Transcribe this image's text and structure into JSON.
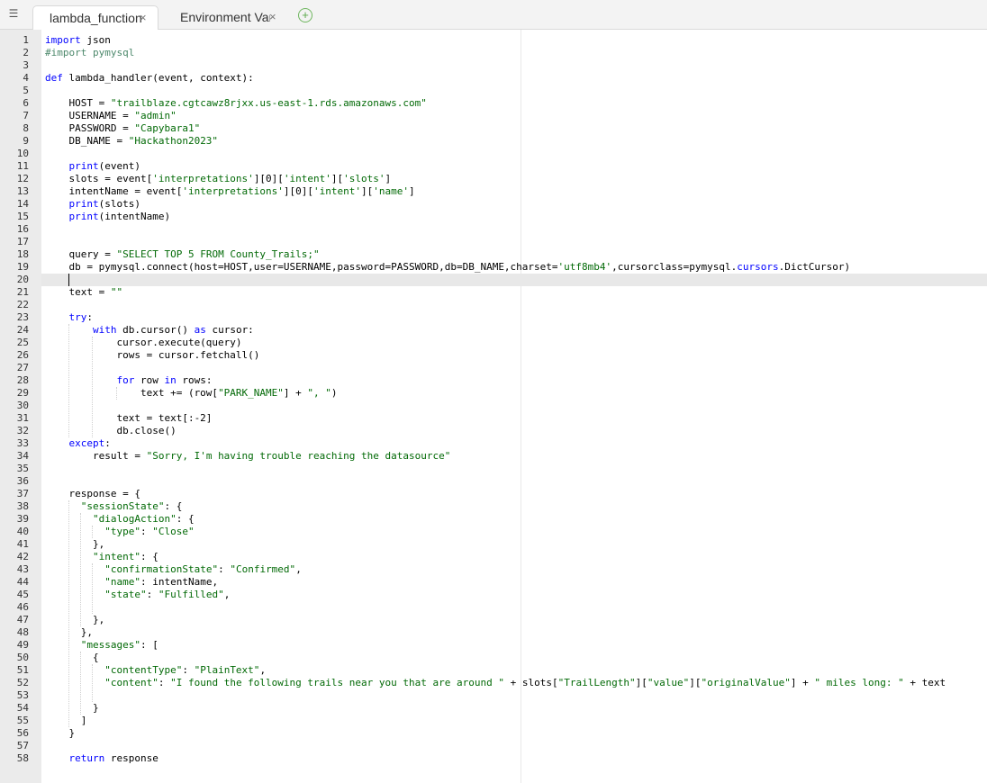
{
  "tabs": [
    {
      "label": "lambda_function",
      "close": "×",
      "active": true
    },
    {
      "label": "Environment Var",
      "close": "×",
      "active": false
    }
  ],
  "add_tab": "+",
  "colors": {
    "keyword": "#0000ff",
    "string": "#036a07",
    "comment": "#4c886b",
    "gutter_bg": "#ebebeb",
    "add_tab": "#5aa84a"
  },
  "icons": {
    "menu": "list-menu-icon",
    "add": "plus-circle-icon",
    "close": "close-icon"
  },
  "editor": {
    "cursor_line": 20,
    "lines": [
      [
        [
          "k",
          "import"
        ],
        [
          "p",
          " json"
        ]
      ],
      [
        [
          "c",
          "#import pymysql"
        ]
      ],
      [],
      [
        [
          "k",
          "def"
        ],
        [
          "p",
          " lambda_handler(event, context):"
        ]
      ],
      [],
      [
        [
          "p",
          "    HOST = "
        ],
        [
          "s",
          "\"trailblaze.cgtcawz8rjxx.us-east-1.rds.amazonaws.com\""
        ]
      ],
      [
        [
          "p",
          "    USERNAME = "
        ],
        [
          "s",
          "\"admin\""
        ]
      ],
      [
        [
          "p",
          "    PASSWORD = "
        ],
        [
          "s",
          "\"Capybara1\""
        ]
      ],
      [
        [
          "p",
          "    DB_NAME = "
        ],
        [
          "s",
          "\"Hackathon2023\""
        ]
      ],
      [],
      [
        [
          "p",
          "    "
        ],
        [
          "k",
          "print"
        ],
        [
          "p",
          "(event)"
        ]
      ],
      [
        [
          "p",
          "    slots = event["
        ],
        [
          "s",
          "'interpretations'"
        ],
        [
          "p",
          "][0]["
        ],
        [
          "s",
          "'intent'"
        ],
        [
          "p",
          "]["
        ],
        [
          "s",
          "'slots'"
        ],
        [
          "p",
          "]"
        ]
      ],
      [
        [
          "p",
          "    intentName = event["
        ],
        [
          "s",
          "'interpretations'"
        ],
        [
          "p",
          "][0]["
        ],
        [
          "s",
          "'intent'"
        ],
        [
          "p",
          "]["
        ],
        [
          "s",
          "'name'"
        ],
        [
          "p",
          "]"
        ]
      ],
      [
        [
          "p",
          "    "
        ],
        [
          "k",
          "print"
        ],
        [
          "p",
          "(slots)"
        ]
      ],
      [
        [
          "p",
          "    "
        ],
        [
          "k",
          "print"
        ],
        [
          "p",
          "(intentName)"
        ]
      ],
      [],
      [],
      [
        [
          "p",
          "    query = "
        ],
        [
          "s",
          "\"SELECT TOP 5 FROM County_Trails;\""
        ]
      ],
      [
        [
          "p",
          "    db = pymysql.connect(host=HOST,user=USERNAME,password=PASSWORD,db=DB_NAME,charset="
        ],
        [
          "s",
          "'utf8mb4'"
        ],
        [
          "p",
          ",cursorclass=pymysql."
        ],
        [
          "k",
          "cursors"
        ],
        [
          "p",
          ".DictCursor)"
        ]
      ],
      [],
      [
        [
          "p",
          "    text = "
        ],
        [
          "s",
          "\"\""
        ]
      ],
      [],
      [
        [
          "p",
          "    "
        ],
        [
          "k",
          "try"
        ],
        [
          "p",
          ":"
        ]
      ],
      [
        [
          "p",
          "        "
        ],
        [
          "k",
          "with"
        ],
        [
          "p",
          " db.cursor() "
        ],
        [
          "k",
          "as"
        ],
        [
          "p",
          " cursor:"
        ]
      ],
      [
        [
          "p",
          "            cursor.execute(query)"
        ]
      ],
      [
        [
          "p",
          "            rows = cursor.fetchall()"
        ]
      ],
      [],
      [
        [
          "p",
          "            "
        ],
        [
          "k",
          "for"
        ],
        [
          "p",
          " row "
        ],
        [
          "k",
          "in"
        ],
        [
          "p",
          " rows:"
        ]
      ],
      [
        [
          "p",
          "                text += (row["
        ],
        [
          "s",
          "\"PARK_NAME\""
        ],
        [
          "p",
          "] + "
        ],
        [
          "s",
          "\", \""
        ],
        [
          "p",
          ")"
        ]
      ],
      [],
      [
        [
          "p",
          "            text = text[:-2]"
        ]
      ],
      [
        [
          "p",
          "            db.close()"
        ]
      ],
      [
        [
          "p",
          "    "
        ],
        [
          "k",
          "except"
        ],
        [
          "p",
          ":"
        ]
      ],
      [
        [
          "p",
          "        result = "
        ],
        [
          "s",
          "\"Sorry, I'm having trouble reaching the datasource\""
        ]
      ],
      [],
      [],
      [
        [
          "p",
          "    response = {"
        ]
      ],
      [
        [
          "p",
          "      "
        ],
        [
          "s",
          "\"sessionState\""
        ],
        [
          "p",
          ": {"
        ]
      ],
      [
        [
          "p",
          "        "
        ],
        [
          "s",
          "\"dialogAction\""
        ],
        [
          "p",
          ": {"
        ]
      ],
      [
        [
          "p",
          "          "
        ],
        [
          "s",
          "\"type\""
        ],
        [
          "p",
          ": "
        ],
        [
          "s",
          "\"Close\""
        ]
      ],
      [
        [
          "p",
          "        },"
        ]
      ],
      [
        [
          "p",
          "        "
        ],
        [
          "s",
          "\"intent\""
        ],
        [
          "p",
          ": {"
        ]
      ],
      [
        [
          "p",
          "          "
        ],
        [
          "s",
          "\"confirmationState\""
        ],
        [
          "p",
          ": "
        ],
        [
          "s",
          "\"Confirmed\""
        ],
        [
          "p",
          ","
        ]
      ],
      [
        [
          "p",
          "          "
        ],
        [
          "s",
          "\"name\""
        ],
        [
          "p",
          ": intentName,"
        ]
      ],
      [
        [
          "p",
          "          "
        ],
        [
          "s",
          "\"state\""
        ],
        [
          "p",
          ": "
        ],
        [
          "s",
          "\"Fulfilled\""
        ],
        [
          "p",
          ","
        ]
      ],
      [],
      [
        [
          "p",
          "        },"
        ]
      ],
      [
        [
          "p",
          "      },"
        ]
      ],
      [
        [
          "p",
          "      "
        ],
        [
          "s",
          "\"messages\""
        ],
        [
          "p",
          ": ["
        ]
      ],
      [
        [
          "p",
          "        {"
        ]
      ],
      [
        [
          "p",
          "          "
        ],
        [
          "s",
          "\"contentType\""
        ],
        [
          "p",
          ": "
        ],
        [
          "s",
          "\"PlainText\""
        ],
        [
          "p",
          ","
        ]
      ],
      [
        [
          "p",
          "          "
        ],
        [
          "s",
          "\"content\""
        ],
        [
          "p",
          ": "
        ],
        [
          "s",
          "\"I found the following trails near you that are around \""
        ],
        [
          "p",
          " + slots["
        ],
        [
          "s",
          "\"TrailLength\""
        ],
        [
          "p",
          "]["
        ],
        [
          "s",
          "\"value\""
        ],
        [
          "p",
          "]["
        ],
        [
          "s",
          "\"originalValue\""
        ],
        [
          "p",
          "] + "
        ],
        [
          "s",
          "\" miles long: \""
        ],
        [
          "p",
          " + text"
        ]
      ],
      [],
      [
        [
          "p",
          "        }"
        ]
      ],
      [
        [
          "p",
          "      ]"
        ]
      ],
      [
        [
          "p",
          "    }"
        ]
      ],
      [],
      [
        [
          "p",
          "    "
        ],
        [
          "k",
          "return"
        ],
        [
          "p",
          " response"
        ]
      ]
    ]
  }
}
